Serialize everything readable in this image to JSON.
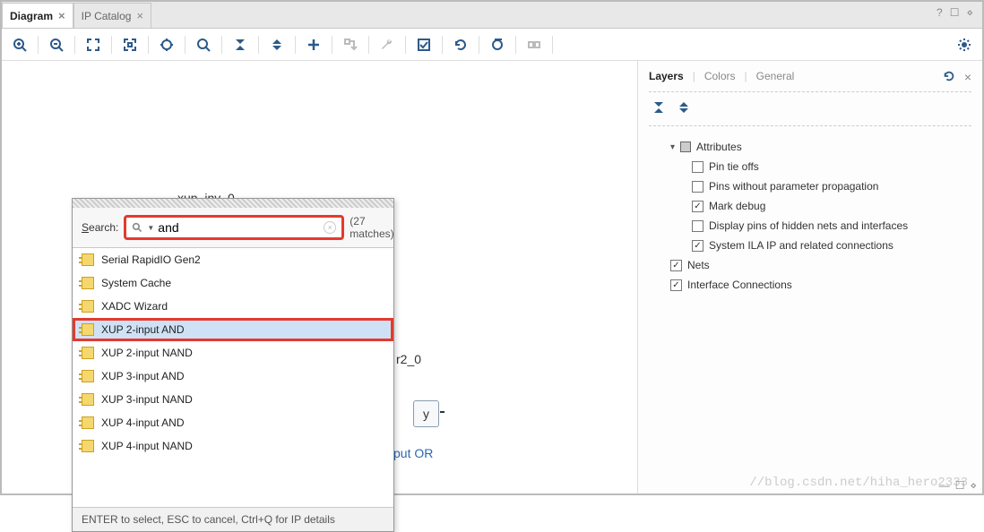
{
  "tabs": {
    "diagram": "Diagram",
    "ip_catalog": "IP Catalog"
  },
  "top_right_icons": {
    "help": "?",
    "maximize": "☐",
    "more": "⋄"
  },
  "toolbar": {
    "zoom_in": "zoom-in-icon",
    "zoom_out": "zoom-out-icon",
    "fit": "fit-icon",
    "fit_sel": "fit-selection-icon",
    "center": "center-icon",
    "search": "search-icon",
    "collapse": "collapse-icon",
    "expand": "expand-icon",
    "add": "add-icon",
    "route": "route-icon",
    "wrench": "wrench-icon",
    "check": "check-icon",
    "refresh": "refresh-icon",
    "cut": "cut-icon",
    "group": "group-icon",
    "settings": "settings-icon"
  },
  "canvas": {
    "block_label": "xup_inv_0",
    "partial_block_name": "r2_0",
    "port": "y",
    "partial_caption": "put OR"
  },
  "popup": {
    "search_label_prefix": "S",
    "search_label_rest": "earch:",
    "search_value": "and",
    "matches_text": "(27 matches)",
    "items": [
      "Serial RapidIO Gen2",
      "System Cache",
      "XADC Wizard",
      "XUP 2-input AND",
      "XUP 2-input NAND",
      "XUP 3-input AND",
      "XUP 3-input NAND",
      "XUP 4-input AND",
      "XUP 4-input NAND"
    ],
    "selected_index": 3,
    "footer": "ENTER to select, ESC to cancel, Ctrl+Q for IP details"
  },
  "side": {
    "tabs": {
      "layers": "Layers",
      "colors": "Colors",
      "general": "General"
    },
    "tree": {
      "attributes": "Attributes",
      "pin_tie_offs": "Pin tie offs",
      "pins_wo_param": "Pins without parameter propagation",
      "mark_debug": "Mark debug",
      "display_hidden": "Display pins of hidden nets and interfaces",
      "sys_ila": "System ILA IP and related connections",
      "nets": "Nets",
      "iface_conn": "Interface Connections"
    }
  },
  "watermark": "//blog.csdn.net/hiha_hero2333"
}
